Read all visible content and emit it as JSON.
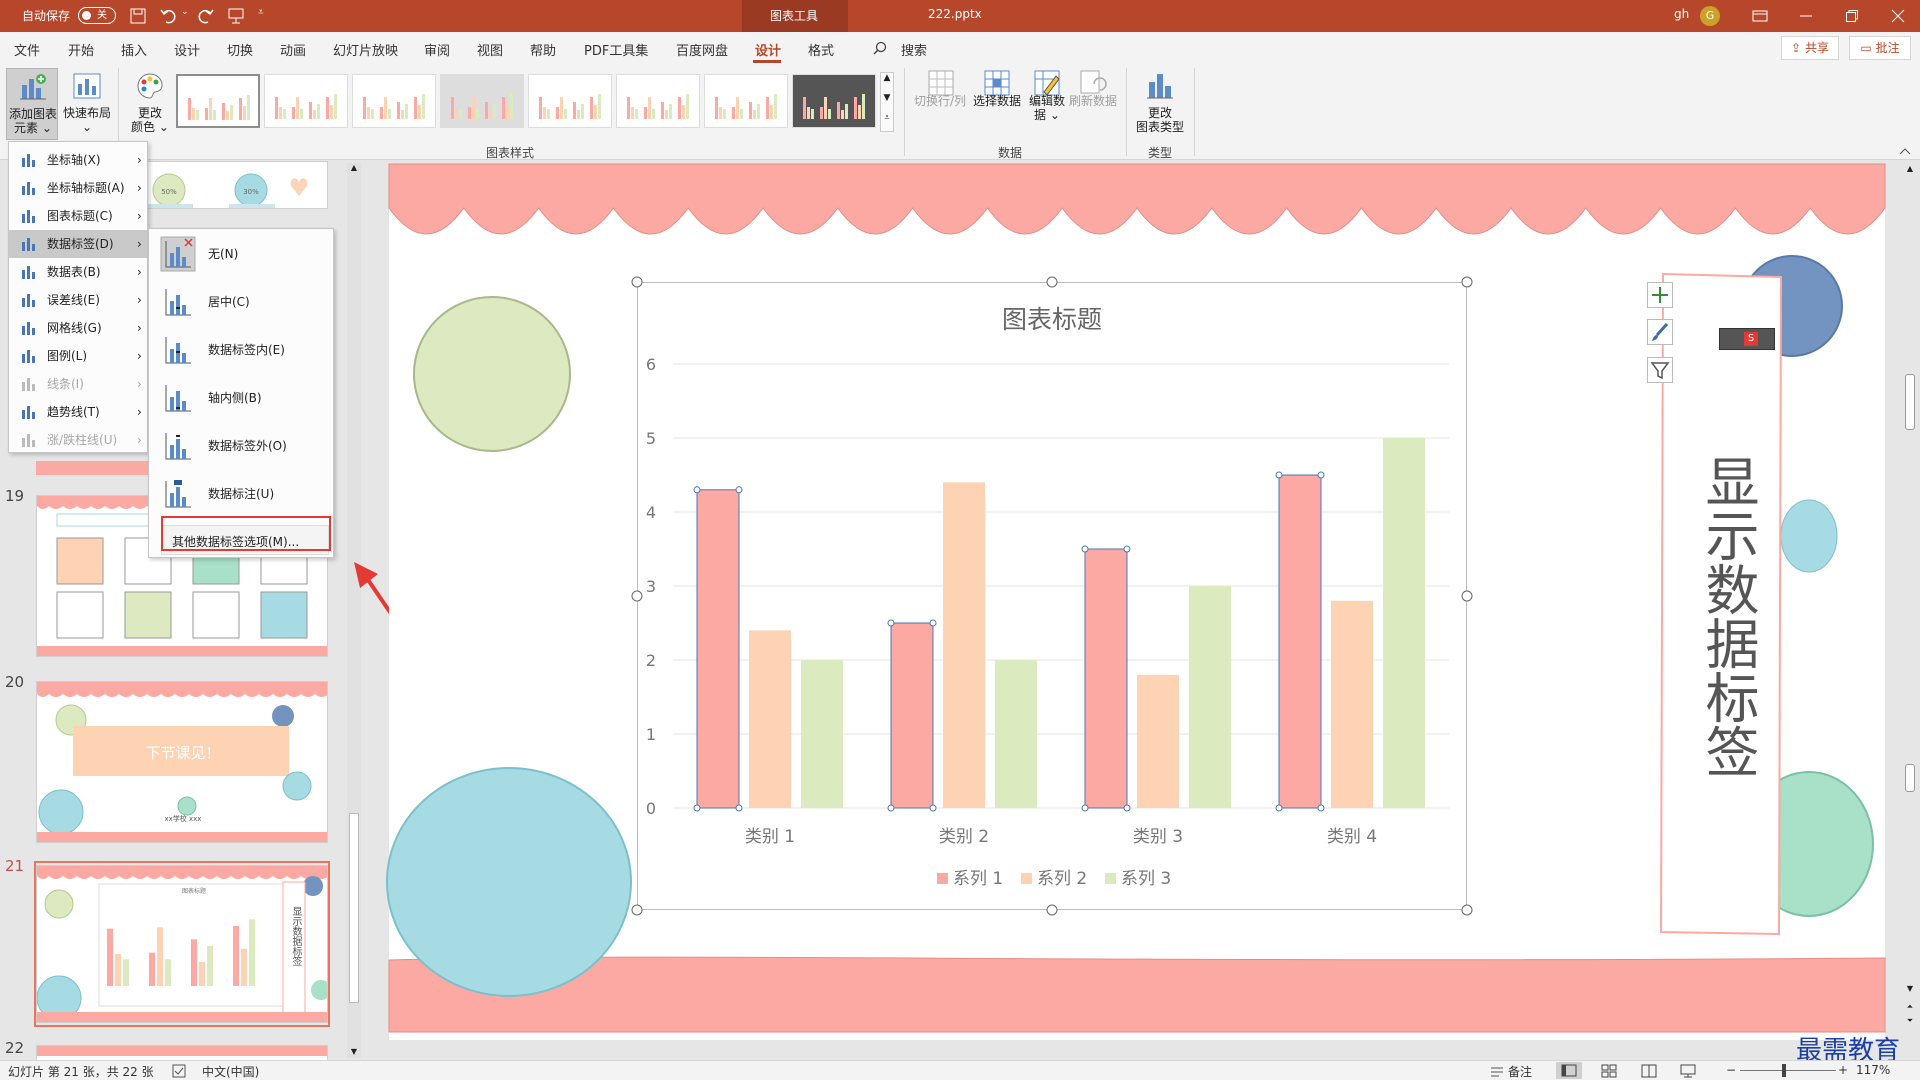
{
  "titlebar": {
    "autosave_label": "自动保存",
    "autosave_state": "关",
    "context_tool": "图表工具",
    "filename": "222.pptx",
    "user": "gh",
    "user_initial": "G"
  },
  "tabs": [
    "文件",
    "开始",
    "插入",
    "设计",
    "切换",
    "动画",
    "幻灯片放映",
    "审阅",
    "视图",
    "帮助",
    "PDF工具集",
    "百度网盘",
    "设计",
    "格式"
  ],
  "active_tab_index": 12,
  "search_label": "搜索",
  "header_buttons": {
    "share": "共享",
    "comment": "批注"
  },
  "ribbon": {
    "add_element": [
      "添加图表",
      "元素"
    ],
    "quick_layout": "快速布局",
    "change_color": [
      "更改",
      "颜色"
    ],
    "switch_rowcol": "切换行/列",
    "select_data": "选择数据",
    "edit_data": [
      "编辑数",
      "据"
    ],
    "refresh_data": "刷新数据",
    "change_type": [
      "更改",
      "图表类型"
    ],
    "groups": {
      "styles": "图表样式",
      "data": "数据",
      "type": "类型"
    }
  },
  "add_element_menu": [
    {
      "label": "坐标轴(X)",
      "icon": "axes-icon",
      "enabled": true
    },
    {
      "label": "坐标轴标题(A)",
      "icon": "axis-title-icon",
      "enabled": true
    },
    {
      "label": "图表标题(C)",
      "icon": "chart-title-icon",
      "enabled": true
    },
    {
      "label": "数据标签(D)",
      "icon": "data-labels-icon",
      "enabled": true
    },
    {
      "label": "数据表(B)",
      "icon": "data-table-icon",
      "enabled": true
    },
    {
      "label": "误差线(E)",
      "icon": "error-bars-icon",
      "enabled": true
    },
    {
      "label": "网格线(G)",
      "icon": "gridlines-icon",
      "enabled": true
    },
    {
      "label": "图例(L)",
      "icon": "legend-icon",
      "enabled": true
    },
    {
      "label": "线条(I)",
      "icon": "lines-icon",
      "enabled": false
    },
    {
      "label": "趋势线(T)",
      "icon": "trendline-icon",
      "enabled": true
    },
    {
      "label": "涨/跌柱线(U)",
      "icon": "updown-bars-icon",
      "enabled": false
    }
  ],
  "data_labels_submenu": [
    {
      "label": "无(N)",
      "icon": "no-label-icon"
    },
    {
      "label": "居中(C)",
      "icon": "center-label-icon"
    },
    {
      "label": "数据标签内(E)",
      "icon": "inside-end-label-icon"
    },
    {
      "label": "轴内侧(B)",
      "icon": "inside-base-label-icon"
    },
    {
      "label": "数据标签外(O)",
      "icon": "outside-end-label-icon"
    },
    {
      "label": "数据标注(U)",
      "icon": "data-callout-icon"
    }
  ],
  "more_options": "其他数据标签选项(M)...",
  "slide_numbers": [
    "19",
    "20",
    "21",
    "22"
  ],
  "thumb20_banner": "下节课见！",
  "thumb20_footer": "xx学校  xxx",
  "thumb21_title": "图表标题",
  "thumb21_side": "显示数据标签",
  "thumb_circle_labels": [
    "50%",
    "30%"
  ],
  "slide_side_text": "显示数据标签",
  "chart_data": {
    "type": "bar",
    "title": "图表标题",
    "categories": [
      "类别 1",
      "类别 2",
      "类别 3",
      "类别 4"
    ],
    "series": [
      {
        "name": "系列 1",
        "values": [
          4.3,
          2.5,
          3.5,
          4.5
        ],
        "color": "#fda9a3"
      },
      {
        "name": "系列 2",
        "values": [
          2.4,
          4.4,
          1.8,
          2.8
        ],
        "color": "#fdd3b4"
      },
      {
        "name": "系列 3",
        "values": [
          2,
          2,
          3,
          5
        ],
        "color": "#dceac0"
      }
    ],
    "yticks": [
      "0",
      "1",
      "2",
      "3",
      "4",
      "5",
      "6"
    ],
    "ylim": [
      0,
      6
    ],
    "legend_position": "bottom",
    "grid": true
  },
  "status": {
    "slide_info": "幻灯片 第 21 张，共 22 张",
    "language": "中文(中国)",
    "notes": "备注",
    "zoom": "117%"
  },
  "watermark": "最需教育"
}
